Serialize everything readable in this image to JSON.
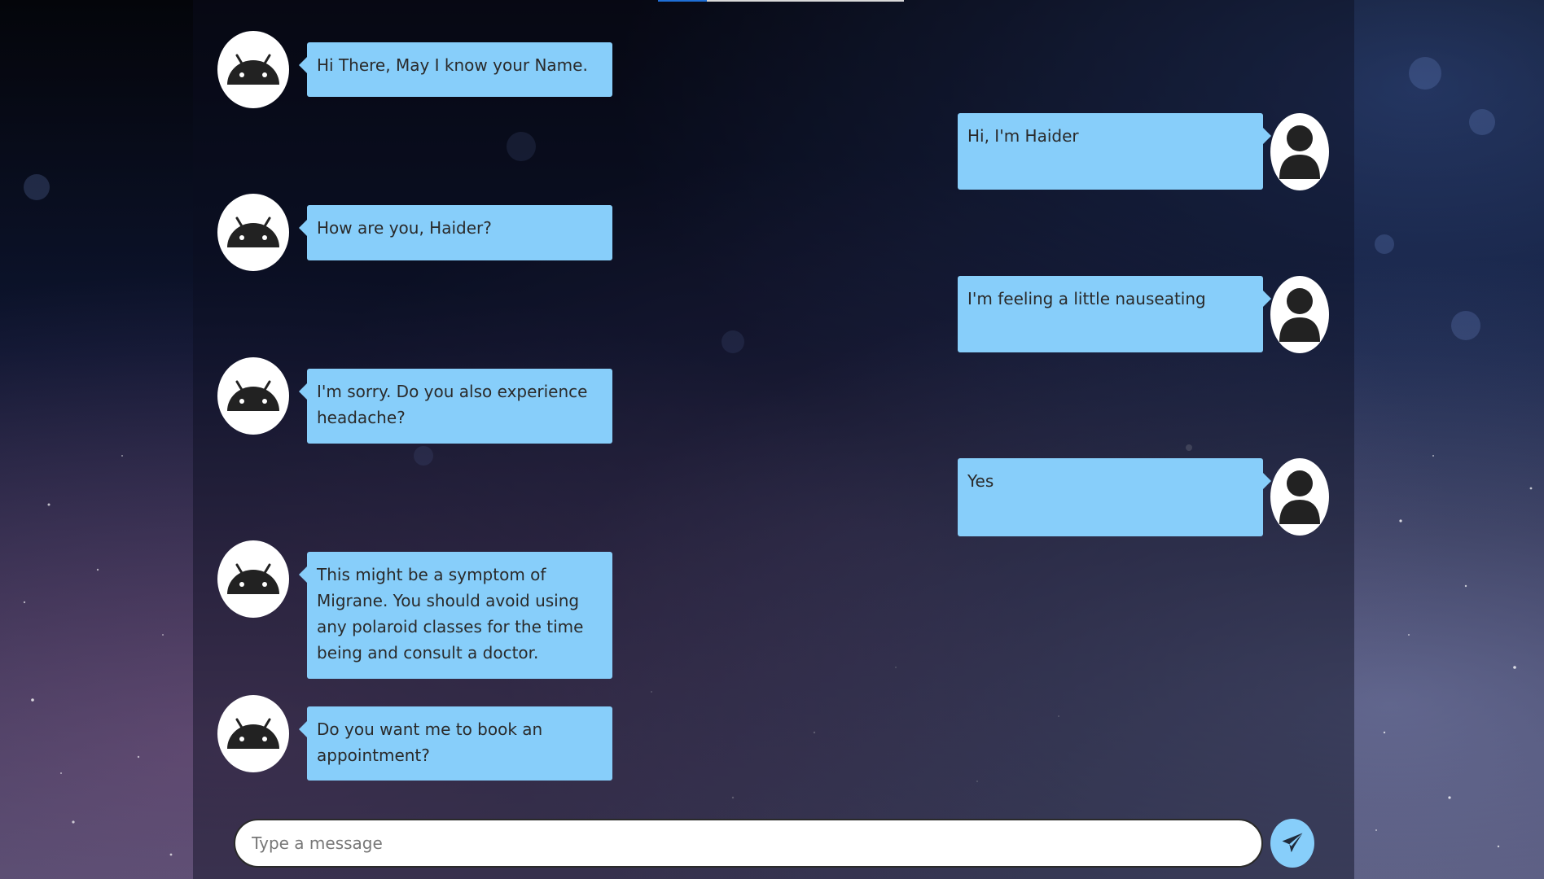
{
  "messages": [
    {
      "sender": "bot",
      "text": "Hi There, May I know your Name."
    },
    {
      "sender": "user",
      "text": "Hi, I'm Haider"
    },
    {
      "sender": "bot",
      "text": "How are you, Haider?"
    },
    {
      "sender": "user",
      "text": "I'm feeling a little nauseating"
    },
    {
      "sender": "bot",
      "text": "I'm sorry. Do you also experience headache?"
    },
    {
      "sender": "user",
      "text": "Yes"
    },
    {
      "sender": "bot",
      "text": "This might be a symptom of Migrane. You should avoid using any polaroid classes for the time being and consult a doctor."
    },
    {
      "sender": "bot",
      "text": "Do you want me to book an appointment?"
    }
  ],
  "composer": {
    "placeholder": "Type a message",
    "value": "",
    "send_icon": "send-icon"
  },
  "icons": {
    "bot_avatar": "android-icon",
    "user_avatar": "user-icon"
  },
  "colors": {
    "bubble": "#87cefa",
    "bubble_text": "#2a2a2a",
    "avatar_bg": "#ffffff",
    "send_button": "#87cefa"
  }
}
